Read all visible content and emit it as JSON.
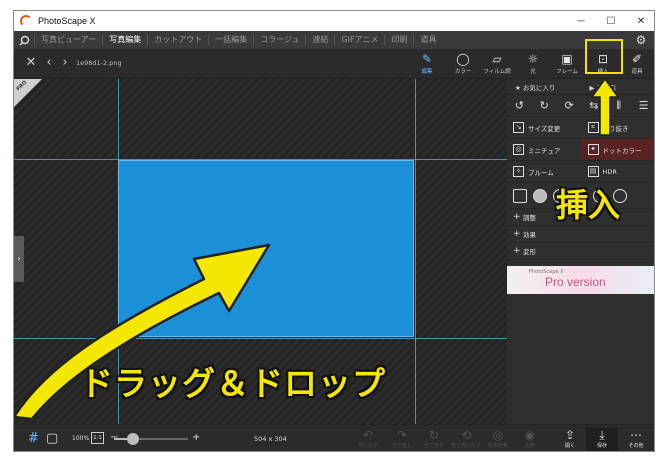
{
  "window": {
    "title": "PhotoScape X",
    "controls": {
      "minimize": "─",
      "maximize": "☐",
      "close": "✕"
    }
  },
  "menu": {
    "items": [
      "写真ビューアー",
      "写真編集",
      "カットアウト",
      "一括編集",
      "コラージュ",
      "連結",
      "GIFアニメ",
      "印刷",
      "道具"
    ],
    "active": "写真編集"
  },
  "toolbar": {
    "filename": "1e98d1-2.png",
    "tools": [
      "編集",
      "カラー",
      "フィルム調",
      "光",
      "フレーム",
      "挿入",
      "道具"
    ],
    "active_tool": "編集"
  },
  "panel": {
    "tabs": [
      "お気に入り",
      "マクロ"
    ],
    "functions": [
      [
        "サイズ変更",
        "切り抜き"
      ],
      [
        "ミニチュア",
        "ドットカラー"
      ],
      [
        "ブルーム",
        "HDR"
      ]
    ],
    "sections": [
      "調整",
      "効果",
      "変形"
    ],
    "ad": {
      "small": "PhotoScape X",
      "big": "Pro version"
    }
  },
  "annotations": {
    "drag_drop": "ドラッグ＆ドロップ",
    "insert": "挿入",
    "pro_badge": "PRO",
    "highlight_color": "#f5e800"
  },
  "statusbar": {
    "zoom": "100%",
    "one_to_one": "1:1",
    "zoom_level": 0.25,
    "dimensions": "504 x 304",
    "actions": [
      "元に戻す",
      "やり直し",
      "全て戻す",
      "全て元に戻す",
      "原本比較",
      "比較",
      "開く",
      "保存",
      "その他"
    ]
  }
}
